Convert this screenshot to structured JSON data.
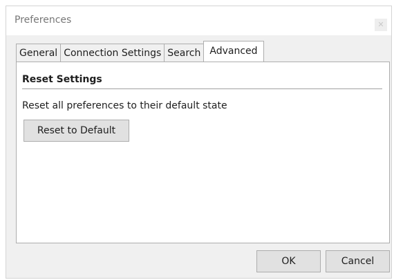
{
  "window": {
    "title": "Preferences",
    "close_glyph": "✕"
  },
  "tabs": [
    {
      "label": "General",
      "active": false
    },
    {
      "label": "Connection Settings",
      "active": false
    },
    {
      "label": "Search",
      "active": false
    },
    {
      "label": "Advanced",
      "active": true
    }
  ],
  "panel": {
    "heading": "Reset Settings",
    "description": "Reset all preferences to their default state",
    "reset_button": "Reset to Default"
  },
  "footer": {
    "ok_label": "OK",
    "cancel_label": "Cancel"
  },
  "colors": {
    "window_bg": "#f0f0f0",
    "panel_bg": "#ffffff",
    "border": "#adadad",
    "button_bg": "#e1e1e1",
    "title_text": "#777777"
  }
}
